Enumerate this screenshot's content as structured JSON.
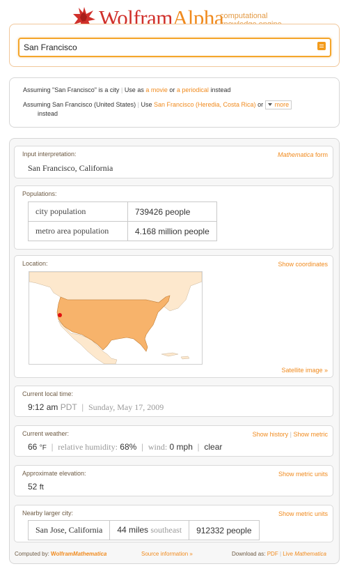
{
  "brand": {
    "name_a": "Wolfram",
    "name_b": "Alpha",
    "tagline_1": "computational",
    "tagline_2": "knowledge engine",
    "star_color": "#d0302b"
  },
  "search": {
    "value": "San Francisco"
  },
  "assumptions": {
    "line1_prefix": "Assuming \"San Francisco\" is a city",
    "line1_use": "Use as",
    "line1_movie": "a movie",
    "line1_or": "or",
    "line1_periodical": "a periodical",
    "line1_suffix": "instead",
    "line2_prefix": "Assuming San Francisco (United States)",
    "line2_use": "Use",
    "line2_alt": "San Francisco (Heredia, Costa Rica)",
    "line2_or": "or",
    "line2_more": "more",
    "line2_suffix": "instead"
  },
  "pods": {
    "input": {
      "title": "Input interpretation:",
      "link_italic": "Mathematica",
      "link_rest": " form",
      "value": "San Francisco, California"
    },
    "populations": {
      "title": "Populations:",
      "rows": [
        {
          "label": "city population",
          "value": "739426",
          "unit": "people"
        },
        {
          "label": "metro area population",
          "value": "4.168",
          "unit": "million people"
        }
      ]
    },
    "location": {
      "title": "Location:",
      "link": "Show coordinates",
      "satellite": "Satellite image »",
      "us_color": "#f7b36b",
      "land_color": "#fde8cd",
      "marker_color": "#e01010"
    },
    "time": {
      "title": "Current local time:",
      "time": "9:12 am",
      "zone": "PDT",
      "date": "Sunday, May 17, 2009"
    },
    "weather": {
      "title": "Current weather:",
      "link_history": "Show history",
      "link_metric": "Show metric",
      "temp": "66",
      "temp_unit": "°F",
      "humidity_label": "relative humidity:",
      "humidity": "68%",
      "wind_label": "wind:",
      "wind": "0",
      "wind_unit": "mph",
      "condition": "clear"
    },
    "elevation": {
      "title": "Approximate elevation:",
      "link": "Show metric units",
      "value": "52",
      "unit": "ft"
    },
    "nearby": {
      "title": "Nearby larger city:",
      "link": "Show metric units",
      "city": "San Jose, California",
      "distance": "44",
      "distance_unit": "miles",
      "direction": "southeast",
      "population": "912332",
      "population_unit": "people"
    }
  },
  "footer": {
    "computed_by": "Computed by:",
    "wolfram": "Wolfram",
    "mathematica": "Mathematica",
    "source": "Source information »",
    "download": "Download as:",
    "pdf": "PDF",
    "live": "Live",
    "live_math": "Mathematica"
  }
}
